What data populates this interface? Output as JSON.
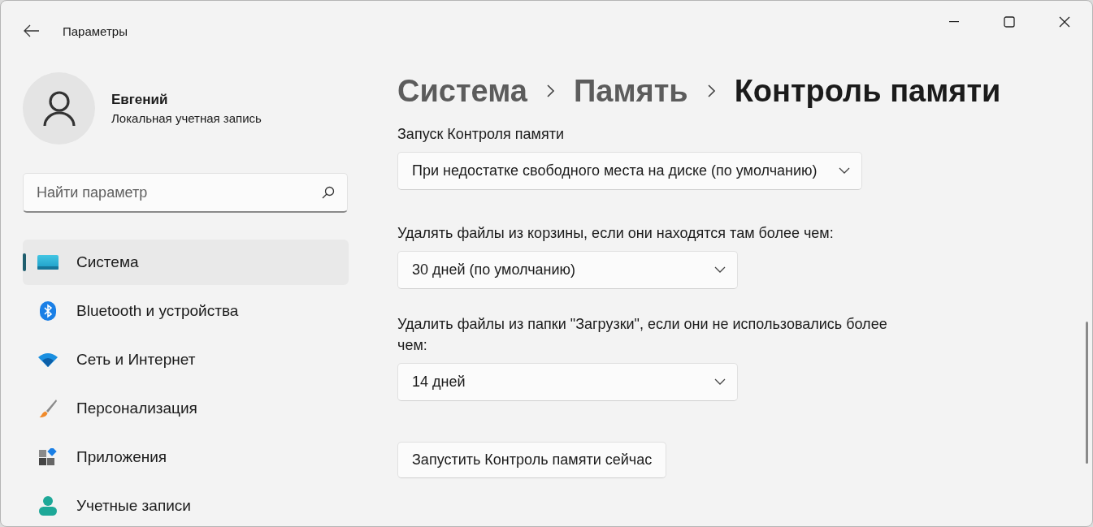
{
  "window": {
    "title": "Параметры"
  },
  "profile": {
    "name": "Евгений",
    "account": "Локальная учетная запись"
  },
  "search": {
    "placeholder": "Найти параметр"
  },
  "sidebar": {
    "items": [
      {
        "label": "Система",
        "kind": "system",
        "selected": true
      },
      {
        "label": "Bluetooth и устройства",
        "kind": "bluetooth",
        "selected": false
      },
      {
        "label": "Сеть и Интернет",
        "kind": "network",
        "selected": false
      },
      {
        "label": "Персонализация",
        "kind": "brush",
        "selected": false
      },
      {
        "label": "Приложения",
        "kind": "apps",
        "selected": false
      },
      {
        "label": "Учетные записи",
        "kind": "account",
        "selected": false
      }
    ]
  },
  "breadcrumb": [
    {
      "label": "Система",
      "current": false
    },
    {
      "label": "Память",
      "current": false
    },
    {
      "label": "Контроль памяти",
      "current": true
    }
  ],
  "settings": [
    {
      "kind": "dropdown",
      "label": "Запуск Контроля памяти",
      "value": "При недостатке свободного места на диске (по умолчанию)"
    },
    {
      "kind": "dropdown",
      "label": "Удалять файлы из корзины, если они находятся там более чем:",
      "value": "30 дней (по умолчанию)"
    },
    {
      "kind": "dropdown",
      "label": "Удалить файлы из папки \"Загрузки\", если они не использовались более чем:",
      "value": "14 дней"
    },
    {
      "kind": "button",
      "label": "Запустить Контроль памяти сейчас"
    }
  ]
}
